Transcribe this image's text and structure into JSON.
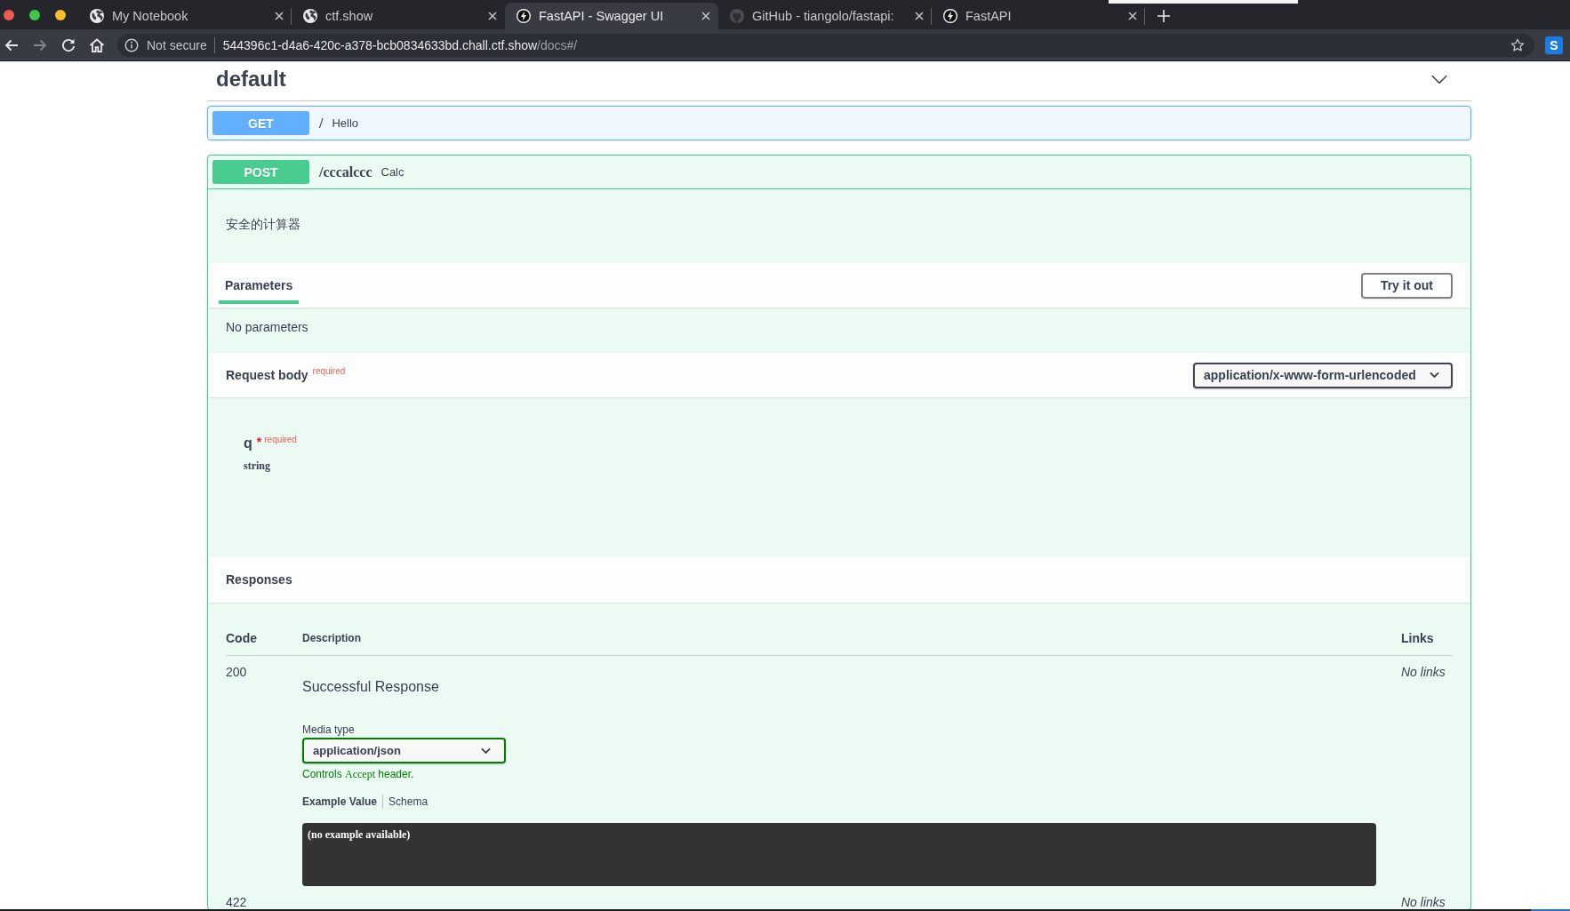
{
  "browser": {
    "tabs": [
      {
        "title": "My Notebook",
        "kind": "globe",
        "selected": false
      },
      {
        "title": "ctf.show",
        "kind": "globe",
        "selected": false
      },
      {
        "title": "FastAPI - Swagger UI",
        "kind": "bolt",
        "selected": true
      },
      {
        "title": "GitHub - tiangolo/fastapi:",
        "kind": "cat",
        "selected": false
      },
      {
        "title": "FastAPI",
        "kind": "bolt",
        "selected": false
      }
    ],
    "security": "Not secure",
    "url": {
      "host": "544396c1-d4a6-420c-a378-bcb0834633bd.chall.ctf.show",
      "path": "/docs#/"
    },
    "extension": "S"
  },
  "section": {
    "title": "default",
    "expanded": true
  },
  "operations": [
    {
      "method": "GET",
      "color": "#61affe",
      "path": "/",
      "summary": "Hello",
      "expanded": false
    },
    {
      "method": "POST",
      "color": "#49cc90",
      "path": "/cccalccc",
      "summary": "Calc",
      "expanded": true,
      "description": "安全的计算器",
      "tabs": [
        {
          "label": "Parameters",
          "selected": true
        }
      ],
      "try_button": "Try it out",
      "no_parameters": "No parameters",
      "request_body": {
        "title": "Request body",
        "required_label": "required",
        "content_type": "application/x-www-form-urlencoded",
        "fields": [
          {
            "name": "q",
            "asterisk": "*",
            "required_label": "required",
            "type": "string"
          }
        ]
      },
      "responses": {
        "title": "Responses",
        "columns": [
          "Code",
          "Description",
          "Links"
        ],
        "rows": [
          {
            "code": "200",
            "description": "Successful Response",
            "media_type_label": "Media type",
            "media_type": "application/json",
            "hint": {
              "before": "Controls ",
              "code": "Accept",
              "after": " header."
            },
            "example_tabs": [
              {
                "label": "Example Value",
                "selected": true
              },
              {
                "label": "Schema",
                "selected": false
              }
            ],
            "example": "(no example available)",
            "links": "No links"
          },
          {
            "code": "422",
            "links": "No links"
          }
        ]
      }
    }
  ]
}
